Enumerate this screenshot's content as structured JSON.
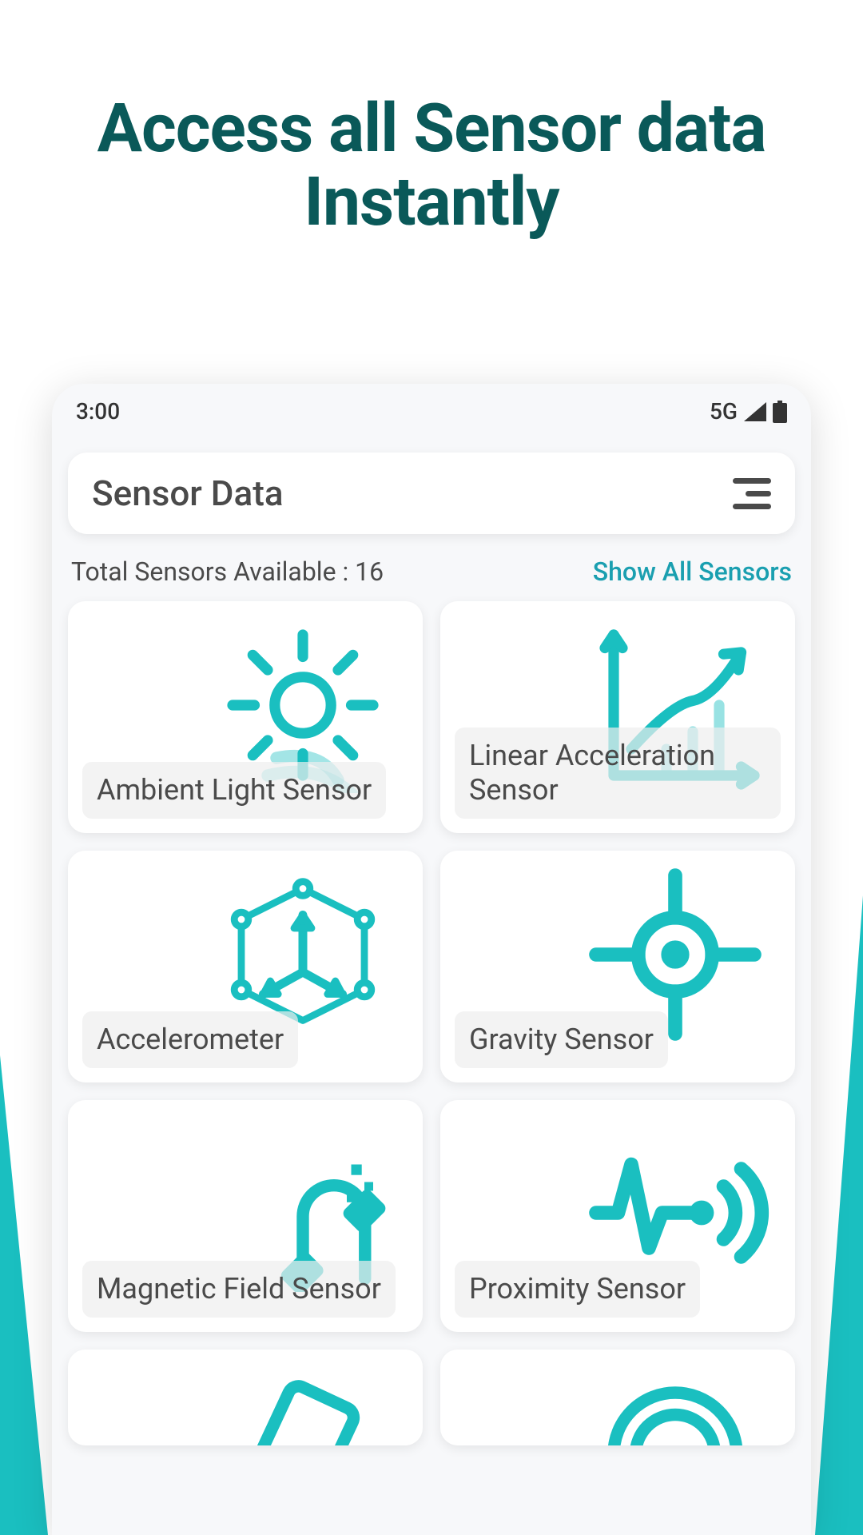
{
  "headline": "Access all Sensor data Instantly",
  "status_bar": {
    "time": "3:00",
    "network": "5G"
  },
  "header": {
    "title": "Sensor Data"
  },
  "summary": {
    "total_label": "Total Sensors Available : 16",
    "show_all": "Show All Sensors"
  },
  "sensors": [
    {
      "name": "Ambient Light Sensor"
    },
    {
      "name": "Linear Acceleration Sensor"
    },
    {
      "name": "Accelerometer"
    },
    {
      "name": "Gravity Sensor"
    },
    {
      "name": "Magnetic Field Sensor"
    },
    {
      "name": "Proximity Sensor"
    }
  ]
}
